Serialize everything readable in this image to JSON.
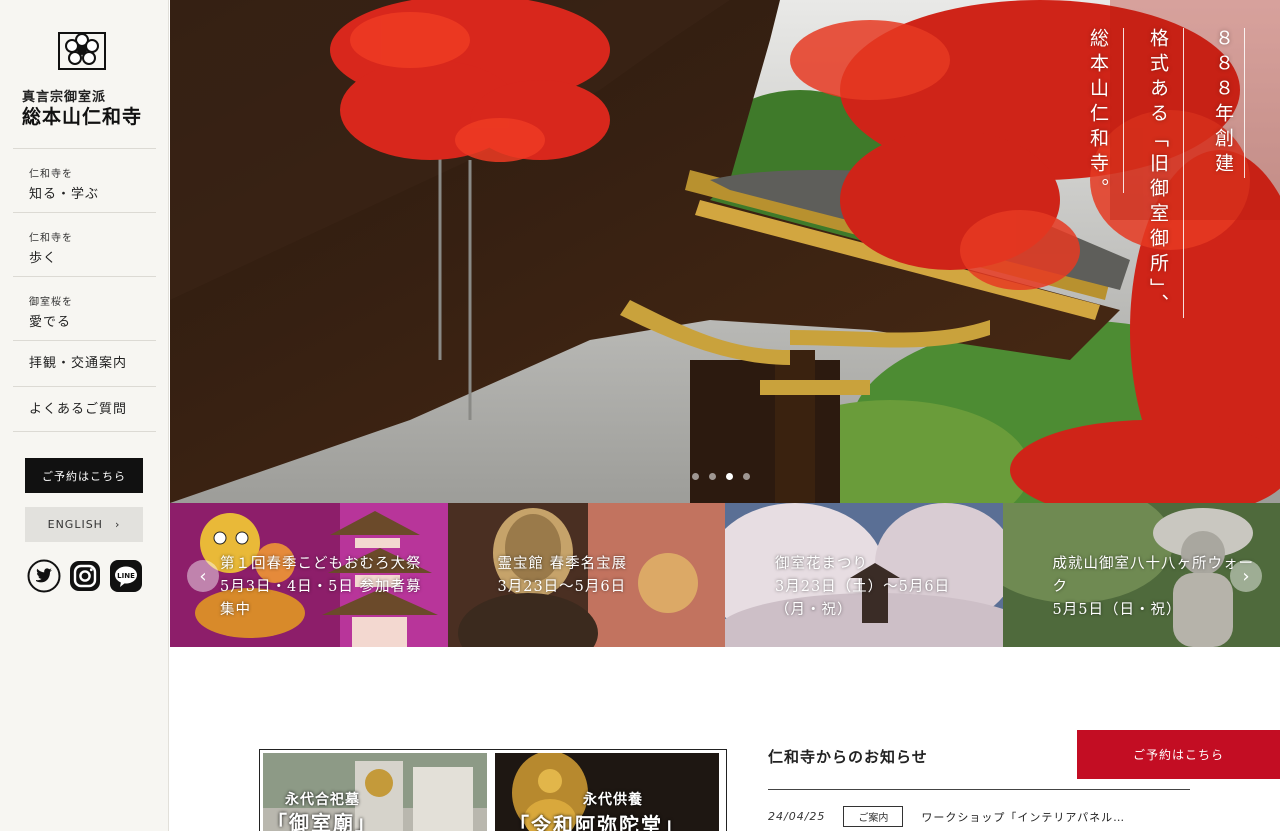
{
  "sidebar": {
    "sect": "真言宗御室派",
    "temple": "総本山仁和寺",
    "nav": [
      {
        "small": "仁和寺を",
        "big": "知る・学ぶ"
      },
      {
        "small": "仁和寺を",
        "big": "歩く"
      },
      {
        "small": "御室桜を",
        "big": "愛でる"
      },
      {
        "big": "拝観・交通案内"
      },
      {
        "big": "よくあるご質問"
      }
    ],
    "reserve_label": "ご予約はこちら",
    "english_label": "ENGLISH",
    "english_chevron": "›",
    "social": [
      "twitter-icon",
      "instagram-icon",
      "line-icon"
    ],
    "line_text": "LINE"
  },
  "hero": {
    "lines": [
      "８８８年創建",
      "格式ある「旧御室御所」、",
      "総本山仁和寺。"
    ],
    "dots": 4,
    "active_dot": 2
  },
  "events": [
    {
      "lines": [
        "第１回春季こどもおむろ大祭",
        "5月3日・4日・5日 参加者募",
        "集中"
      ]
    },
    {
      "lines": [
        "霊宝館 春季名宝展",
        "3月23日〜5月6日"
      ]
    },
    {
      "lines": [
        "御室花まつり",
        "3月23日（土）〜5月6日",
        "（月・祝）"
      ]
    },
    {
      "lines": [
        "成就山御室八十八ヶ所ウォー",
        "ク",
        "5月5日（日・祝）"
      ]
    }
  ],
  "carousel": {
    "prev": "‹",
    "next": "›"
  },
  "banners": [
    {
      "label": "永代合祀墓",
      "title": "「御室廟」"
    },
    {
      "label": "永代供養",
      "title": "「令和阿弥陀堂」"
    }
  ],
  "news": {
    "heading": "仁和寺からのお知らせ",
    "items": [
      {
        "date": "24/04/25",
        "tag": "ご案内",
        "title": "ワークショップ「インテリアパネル…"
      }
    ]
  },
  "reserve_main_label": "ご予約はこちら",
  "colors": {
    "accent_red": "#c30d23",
    "sidebar_bg": "#f7f6f2",
    "dark_button": "#111111"
  }
}
